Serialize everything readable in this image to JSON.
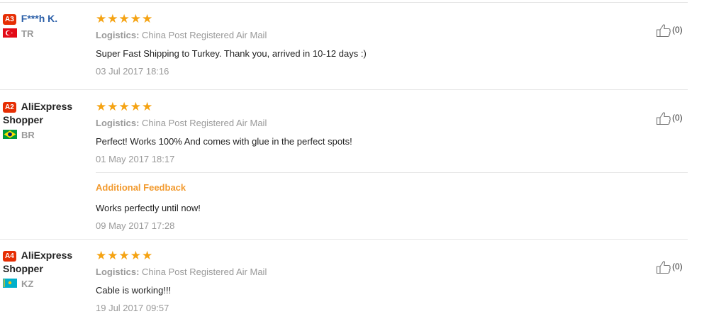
{
  "reviews": [
    {
      "badge": "A3",
      "user": "F***h K.",
      "country": "TR",
      "rating": "★★★★★",
      "logistics_label": "Logistics:",
      "logistics": "China Post Registered Air Mail",
      "text": "Super Fast Shipping to Turkey. Thank you, arrived in 10-12 days :)",
      "date": "03 Jul 2017 18:16",
      "helpful": "(0)"
    },
    {
      "badge": "A2",
      "user": "AliExpress Shopper",
      "country": "BR",
      "rating": "★★★★★",
      "logistics_label": "Logistics:",
      "logistics": "China Post Registered Air Mail",
      "text": "Perfect! Works 100% And comes with glue in the perfect spots!",
      "date": "01 May 2017 18:17",
      "additional_label": "Additional Feedback",
      "additional_text": "Works perfectly until now!",
      "additional_date": "09 May 2017 17:28",
      "helpful": "(0)"
    },
    {
      "badge": "A4",
      "user": "AliExpress Shopper",
      "country": "KZ",
      "rating": "★★★★★",
      "logistics_label": "Logistics:",
      "logistics": "China Post Registered Air Mail",
      "text": "Cable is working!!!",
      "date": "19 Jul 2017 09:57",
      "helpful": "(0)"
    }
  ],
  "colors": {
    "badge": "#e62e04",
    "stars": "#f5a313",
    "additional": "#f29a2e",
    "username_link": "#2b5fa8"
  },
  "icons": {
    "thumb": "thumbs-up-icon",
    "flag_tr": "flag-turkey-icon",
    "flag_br": "flag-brazil-icon",
    "flag_kz": "flag-kazakhstan-icon"
  }
}
